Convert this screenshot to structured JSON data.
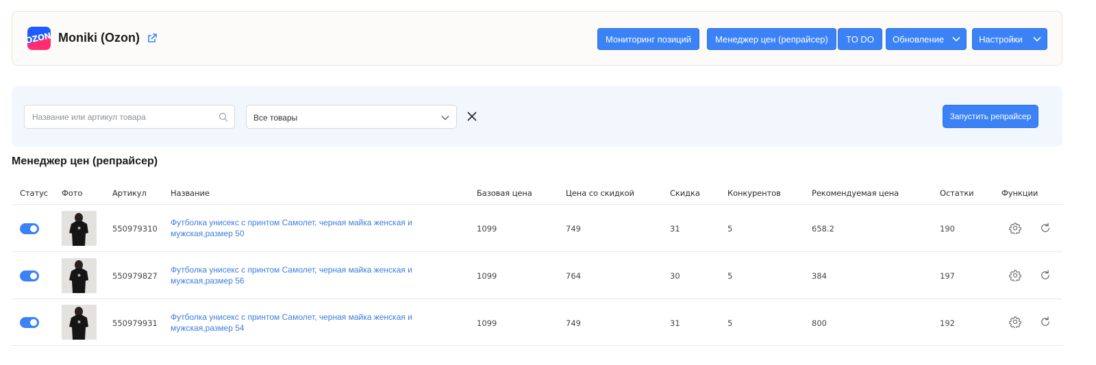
{
  "store": {
    "logo_text": "OZON",
    "name": "Moniki (Ozon)"
  },
  "toolbar": {
    "monitoring_label": "Мониторинг позиций",
    "repricer_label": "Менеджер цен (репрайсер)",
    "todo_label": "TO DO",
    "update_label": "Обновление",
    "settings_label": "Настройки"
  },
  "filters": {
    "search_placeholder": "Название или артикул товара",
    "search_value": "",
    "select_value": "Все товары",
    "run_label": "Запустить репрайсер"
  },
  "section_title": "Менеджер цен (репрайсер)",
  "table": {
    "headers": [
      "Статус",
      "Фото",
      "Артикул",
      "Название",
      "Базовая цена",
      "Цена со скидкой",
      "Скидка",
      "Конкурентов",
      "Рекомендуемая цена",
      "Остатки",
      "Функции"
    ],
    "rows": [
      {
        "status_on": true,
        "sku": "550979310",
        "name_line1": "Футболка унисекс с принтом Самолет, черная майка женская и",
        "name_line2": "мужская,размер 50",
        "base_price": "1099",
        "discount_price": "749",
        "discount": "31",
        "competitors": "5",
        "recommended_price": "658.2",
        "stock": "190"
      },
      {
        "status_on": true,
        "sku": "550979827",
        "name_line1": "Футболка унисекс с принтом Самолет, черная майка женская и",
        "name_line2": "мужская,размер 56",
        "base_price": "1099",
        "discount_price": "764",
        "discount": "30",
        "competitors": "5",
        "recommended_price": "384",
        "stock": "197"
      },
      {
        "status_on": true,
        "sku": "550979931",
        "name_line1": "Футболка унисекс с принтом Самолет, черная майка женская и",
        "name_line2": "мужская,размер 54",
        "base_price": "1099",
        "discount_price": "749",
        "discount": "31",
        "competitors": "5",
        "recommended_price": "800",
        "stock": "192"
      }
    ]
  },
  "icons": {
    "external": "external-link-icon",
    "search": "search-icon",
    "clear": "close-icon",
    "settings": "gear-icon",
    "refresh": "refresh-icon"
  },
  "colors": {
    "accent": "#3b82f6",
    "link": "#3b7ddd",
    "panel": "#f2f7fd"
  }
}
